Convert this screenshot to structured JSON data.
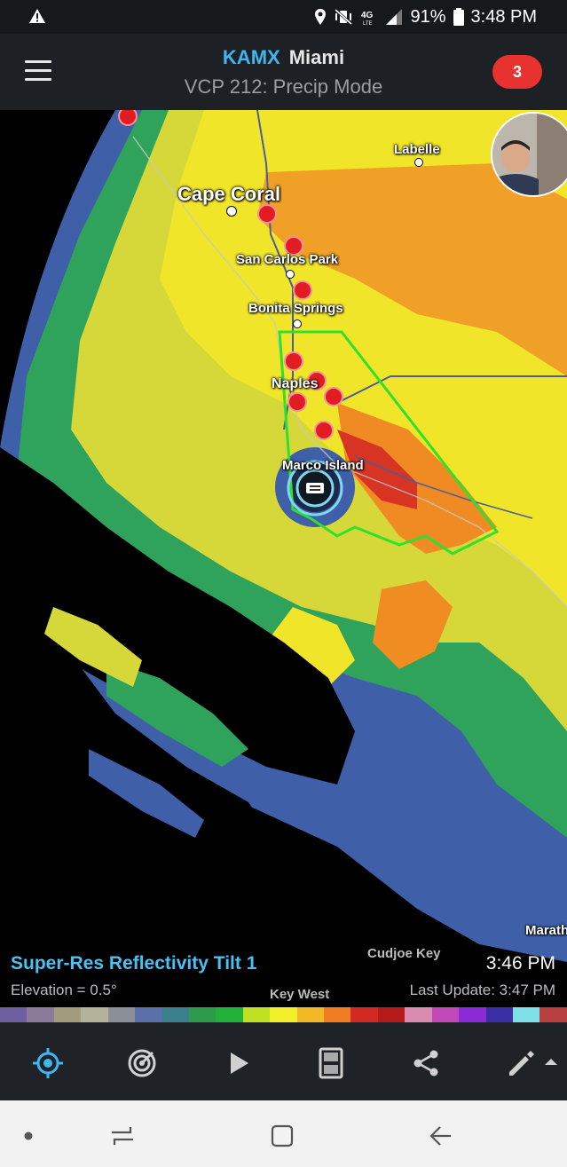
{
  "status_bar": {
    "battery": "91%",
    "time": "3:48 PM",
    "icons": [
      "warning-icon",
      "location-icon",
      "mute-vibrate-icon",
      "4g-lte-icon",
      "signal-icon",
      "battery-icon"
    ]
  },
  "header": {
    "station": "KAMX",
    "city": "Miami",
    "subtitle": "VCP 212: Precip Mode",
    "alert_count": "3"
  },
  "map": {
    "labels": {
      "labelle": "Labelle",
      "cape_coral": "Cape Coral",
      "san_carlos_park": "San Carlos Park",
      "bonita_springs": "Bonita Springs",
      "naples": "Naples",
      "marco_island": "Marco Island",
      "cudjoe_key": "Cudjoe Key",
      "key_west": "Key West",
      "marathon": "Marath"
    },
    "warning_polygon_color": "#2fe02f",
    "marker_color": "#e31b23"
  },
  "product": {
    "name": "Super-Res Reflectivity Tilt 1",
    "elevation": "Elevation = 0.5°",
    "scan_time": "3:46 PM",
    "last_update": "Last Update: 3:47 PM"
  },
  "color_scale": [
    "#6e5fa0",
    "#8c7a9a",
    "#a39c7c",
    "#b4b29a",
    "#8a8f98",
    "#5a6fa8",
    "#3c7f8c",
    "#2d9a4c",
    "#22b23a",
    "#bfe020",
    "#f1f02a",
    "#f2b825",
    "#f07d21",
    "#d22a22",
    "#b51a1a",
    "#d98bb0",
    "#c249b9",
    "#8a2bd6",
    "#3a2fa6",
    "#7fdfe8",
    "#b84040"
  ],
  "toolbar": {
    "items": [
      "locate-icon",
      "radar-sweep-icon",
      "play-icon",
      "layers-icon",
      "share-icon",
      "edit-icon"
    ]
  },
  "nav": {
    "items": [
      "dot-icon",
      "recents-icon",
      "home-icon",
      "back-icon"
    ]
  }
}
